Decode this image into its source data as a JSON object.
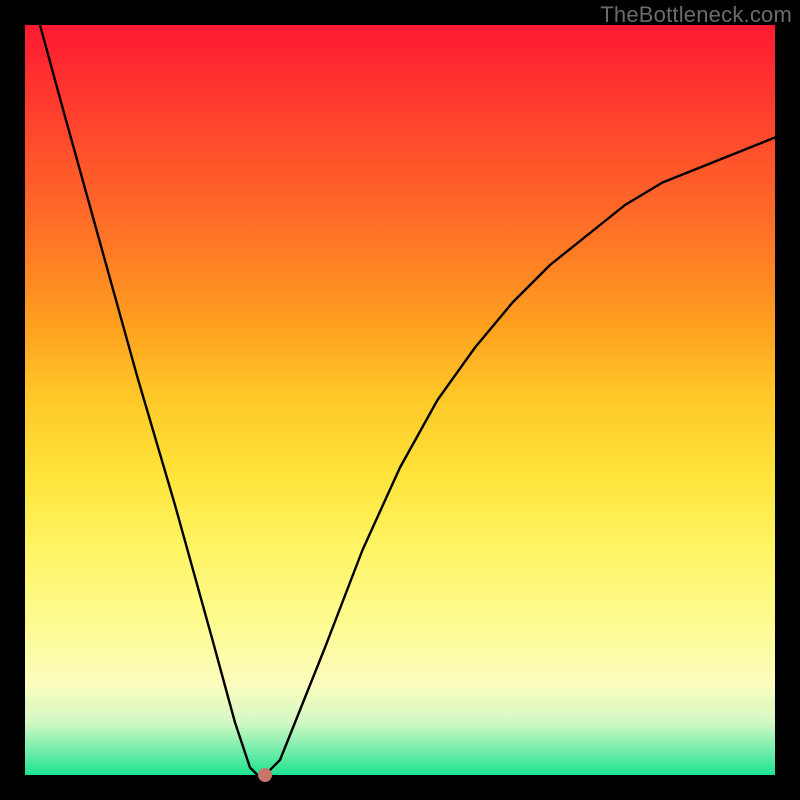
{
  "watermark": "TheBottleneck.com",
  "chart_data": {
    "type": "line",
    "title": "",
    "xlabel": "",
    "ylabel": "",
    "xlim": [
      0,
      100
    ],
    "ylim": [
      0,
      100
    ],
    "grid": false,
    "series": [
      {
        "name": "curve",
        "x": [
          2,
          5,
          10,
          15,
          20,
          25,
          28,
          30,
          31,
          32,
          34,
          36,
          40,
          45,
          50,
          55,
          60,
          65,
          70,
          75,
          80,
          85,
          90,
          95,
          100
        ],
        "values": [
          100,
          89,
          71,
          53,
          36,
          18,
          7,
          1,
          0,
          0,
          2,
          7,
          17,
          30,
          41,
          50,
          57,
          63,
          68,
          72,
          76,
          79,
          81,
          83,
          85
        ]
      }
    ],
    "marker": {
      "x": 32,
      "y": 0
    },
    "background_gradient": {
      "top": "#ff1a33",
      "bottom": "#1de28f"
    },
    "frame_color": "#000000"
  }
}
